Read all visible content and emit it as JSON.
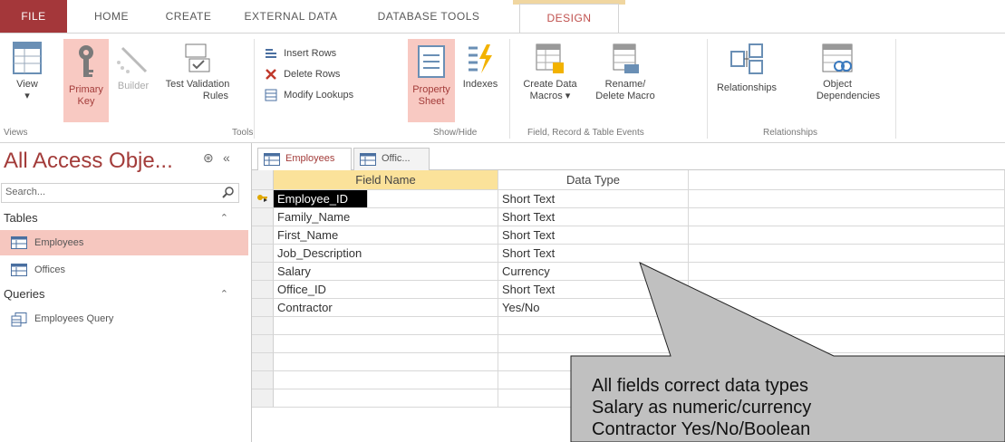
{
  "ribbon_tabs": [
    "FILE",
    "HOME",
    "CREATE",
    "EXTERNAL DATA",
    "DATABASE TOOLS",
    "DESIGN"
  ],
  "ribbon": {
    "view": {
      "label": "View",
      "arrow": "▾"
    },
    "primary_key": {
      "line1": "Primary",
      "line2": "Key"
    },
    "builder": "Builder",
    "test_validation": {
      "line1": "Test Validation",
      "line2": "Rules"
    },
    "insert_rows": "Insert Rows",
    "delete_rows": "Delete Rows",
    "modify_lookups": "Modify Lookups",
    "property_sheet": {
      "line1": "Property",
      "line2": "Sheet"
    },
    "indexes": "Indexes",
    "create_data_macros": {
      "line1": "Create Data",
      "line2": "Macros ▾"
    },
    "rename_delete_macro": {
      "line1": "Rename/",
      "line2": "Delete Macro"
    },
    "relationships": "Relationships",
    "object_dependencies": {
      "line1": "Object",
      "line2": "Dependencies"
    },
    "groups": {
      "views": "Views",
      "tools": "Tools",
      "show_hide": "Show/Hide",
      "field_record_table_events": "Field, Record & Table Events",
      "relationships": "Relationships"
    }
  },
  "nav": {
    "title": "All Access Obje...",
    "ctrl_icon": "⊛",
    "collapse_icon": "«",
    "search_placeholder": "Search...",
    "sections": [
      {
        "label": "Tables",
        "chevron": "⌃",
        "items": [
          "Employees",
          "Offices"
        ]
      },
      {
        "label": "Queries",
        "chevron": "⌃",
        "items": [
          "Employees Query"
        ]
      }
    ]
  },
  "doc_tabs": [
    "Employees",
    "Offic..."
  ],
  "grid": {
    "headers": [
      "Field Name",
      "Data Type"
    ],
    "rows": [
      {
        "field": "Employee_ID",
        "type": "Short Text"
      },
      {
        "field": "Family_Name",
        "type": "Short Text"
      },
      {
        "field": "First_Name",
        "type": "Short Text"
      },
      {
        "field": "Job_Description",
        "type": "Short Text"
      },
      {
        "field": "Salary",
        "type": "Currency"
      },
      {
        "field": "Office_ID",
        "type": "Short Text"
      },
      {
        "field": "Contractor",
        "type": "Yes/No"
      }
    ],
    "empty_rows": 5
  },
  "callout": {
    "lines": [
      "All fields correct data types",
      "Salary as numeric/currency",
      "Contractor Yes/No/Boolean"
    ],
    "fill": "#c0c0c0"
  },
  "colors": {
    "accent": "#a4373a",
    "selected": "#f6c7bf",
    "header_highlight": "#fbe29a"
  }
}
